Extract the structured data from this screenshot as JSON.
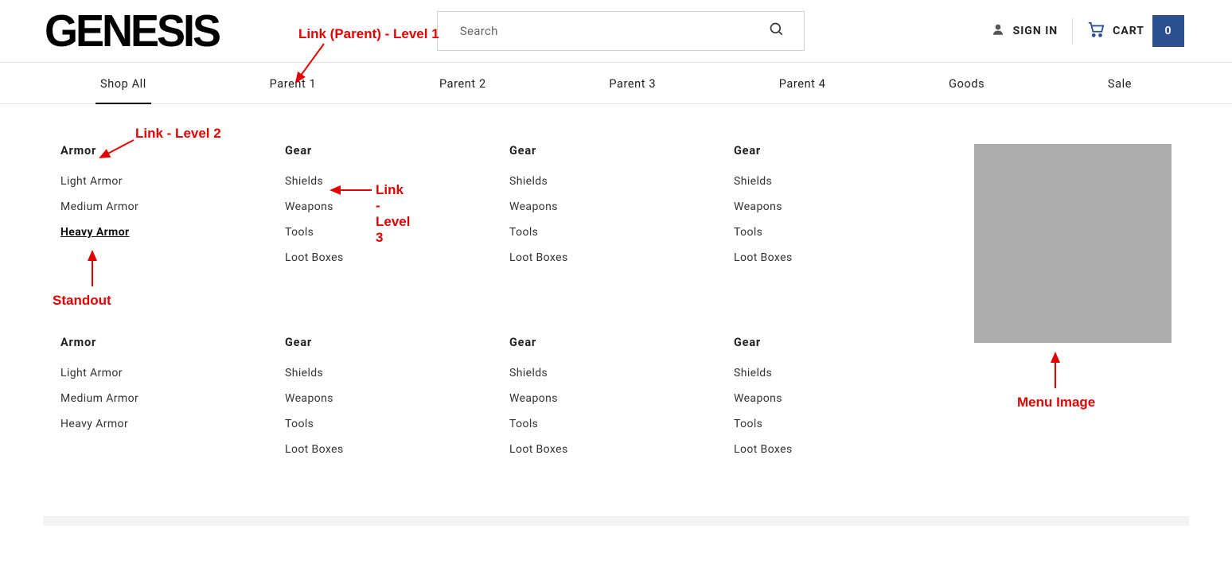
{
  "header": {
    "logo": "GENESIS",
    "search_placeholder": "Search",
    "signin_label": "SIGN IN",
    "cart_label": "CART",
    "cart_count": "0"
  },
  "nav": {
    "items": [
      {
        "label": "Shop All",
        "active": true
      },
      {
        "label": "Parent 1"
      },
      {
        "label": "Parent 2"
      },
      {
        "label": "Parent 3"
      },
      {
        "label": "Parent 4"
      },
      {
        "label": "Goods"
      },
      {
        "label": "Sale"
      }
    ]
  },
  "mega": {
    "columns": [
      {
        "header": "Armor",
        "links": [
          {
            "label": "Light Armor"
          },
          {
            "label": "Medium Armor"
          },
          {
            "label": "Heavy Armor",
            "standout": true
          }
        ]
      },
      {
        "header": "Gear",
        "links": [
          {
            "label": "Shields"
          },
          {
            "label": "Weapons"
          },
          {
            "label": "Tools"
          },
          {
            "label": "Loot Boxes"
          }
        ]
      },
      {
        "header": "Gear",
        "links": [
          {
            "label": "Shields"
          },
          {
            "label": "Weapons"
          },
          {
            "label": "Tools"
          },
          {
            "label": "Loot Boxes"
          }
        ]
      },
      {
        "header": "Gear",
        "links": [
          {
            "label": "Shields"
          },
          {
            "label": "Weapons"
          },
          {
            "label": "Tools"
          },
          {
            "label": "Loot Boxes"
          }
        ]
      },
      {
        "header": "Armor",
        "links": [
          {
            "label": "Light Armor"
          },
          {
            "label": "Medium Armor"
          },
          {
            "label": "Heavy Armor"
          }
        ]
      },
      {
        "header": "Gear",
        "links": [
          {
            "label": "Shields"
          },
          {
            "label": "Weapons"
          },
          {
            "label": "Tools"
          },
          {
            "label": "Loot Boxes"
          }
        ]
      },
      {
        "header": "Gear",
        "links": [
          {
            "label": "Shields"
          },
          {
            "label": "Weapons"
          },
          {
            "label": "Tools"
          },
          {
            "label": "Loot Boxes"
          }
        ]
      },
      {
        "header": "Gear",
        "links": [
          {
            "label": "Shields"
          },
          {
            "label": "Weapons"
          },
          {
            "label": "Tools"
          },
          {
            "label": "Loot Boxes"
          }
        ]
      }
    ]
  },
  "annotations": {
    "level1": "Link (Parent) - Level 1",
    "level2": "Link - Level 2",
    "level3": "Link - Level 3",
    "standout": "Standout",
    "menu_image": "Menu Image"
  }
}
